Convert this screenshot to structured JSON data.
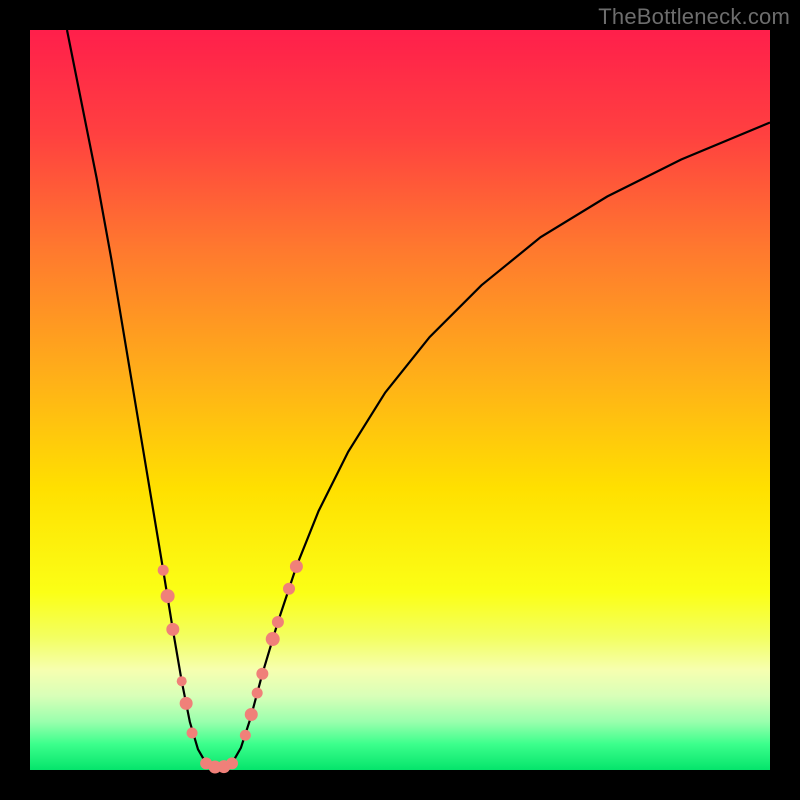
{
  "watermark": "TheBottleneck.com",
  "chart_data": {
    "type": "line",
    "title": "",
    "xlabel": "",
    "ylabel": "",
    "xlim": [
      0,
      100
    ],
    "ylim": [
      0,
      100
    ],
    "grid": false,
    "legend": false,
    "background_gradient": {
      "stops": [
        {
          "offset": 0.0,
          "color": "#ff1f4b"
        },
        {
          "offset": 0.14,
          "color": "#ff4040"
        },
        {
          "offset": 0.3,
          "color": "#ff7a2e"
        },
        {
          "offset": 0.48,
          "color": "#ffb317"
        },
        {
          "offset": 0.62,
          "color": "#ffe000"
        },
        {
          "offset": 0.76,
          "color": "#fbff16"
        },
        {
          "offset": 0.82,
          "color": "#f3ff60"
        },
        {
          "offset": 0.865,
          "color": "#f6ffb0"
        },
        {
          "offset": 0.9,
          "color": "#d8ffb8"
        },
        {
          "offset": 0.935,
          "color": "#99ffad"
        },
        {
          "offset": 0.965,
          "color": "#3cff8c"
        },
        {
          "offset": 1.0,
          "color": "#05e46b"
        }
      ]
    },
    "series": [
      {
        "name": "curve",
        "stroke": "#000000",
        "stroke_width": 2.2,
        "points": [
          {
            "x": 5.0,
            "y": 100.0
          },
          {
            "x": 7.0,
            "y": 90.0
          },
          {
            "x": 9.0,
            "y": 80.0
          },
          {
            "x": 11.0,
            "y": 69.0
          },
          {
            "x": 13.0,
            "y": 57.0
          },
          {
            "x": 15.0,
            "y": 45.0
          },
          {
            "x": 16.5,
            "y": 36.0
          },
          {
            "x": 18.0,
            "y": 27.0
          },
          {
            "x": 19.3,
            "y": 19.0
          },
          {
            "x": 20.5,
            "y": 12.0
          },
          {
            "x": 21.6,
            "y": 6.5
          },
          {
            "x": 22.7,
            "y": 2.8
          },
          {
            "x": 23.8,
            "y": 0.9
          },
          {
            "x": 25.6,
            "y": 0.3
          },
          {
            "x": 27.3,
            "y": 0.9
          },
          {
            "x": 28.5,
            "y": 3.0
          },
          {
            "x": 29.8,
            "y": 7.0
          },
          {
            "x": 31.4,
            "y": 13.0
          },
          {
            "x": 33.5,
            "y": 20.0
          },
          {
            "x": 36.0,
            "y": 27.5
          },
          {
            "x": 39.0,
            "y": 35.0
          },
          {
            "x": 43.0,
            "y": 43.0
          },
          {
            "x": 48.0,
            "y": 51.0
          },
          {
            "x": 54.0,
            "y": 58.5
          },
          {
            "x": 61.0,
            "y": 65.5
          },
          {
            "x": 69.0,
            "y": 72.0
          },
          {
            "x": 78.0,
            "y": 77.5
          },
          {
            "x": 88.0,
            "y": 82.5
          },
          {
            "x": 100.0,
            "y": 87.5
          }
        ]
      }
    ],
    "markers": {
      "color": "#f08079",
      "stroke": "#f08079",
      "groups": [
        {
          "name": "left-descending",
          "points": [
            {
              "x": 18.0,
              "y": 27.0,
              "r": 5.5
            },
            {
              "x": 18.6,
              "y": 23.5,
              "r": 7.0
            },
            {
              "x": 19.3,
              "y": 19.0,
              "r": 6.5
            },
            {
              "x": 20.5,
              "y": 12.0,
              "r": 5.0
            },
            {
              "x": 21.1,
              "y": 9.0,
              "r": 6.5
            },
            {
              "x": 21.9,
              "y": 5.0,
              "r": 5.5
            }
          ]
        },
        {
          "name": "valley-bottom",
          "points": [
            {
              "x": 23.8,
              "y": 0.9,
              "r": 6.0
            },
            {
              "x": 25.0,
              "y": 0.4,
              "r": 6.5
            },
            {
              "x": 26.2,
              "y": 0.45,
              "r": 6.5
            },
            {
              "x": 27.3,
              "y": 0.9,
              "r": 6.0
            }
          ]
        },
        {
          "name": "right-ascending",
          "points": [
            {
              "x": 29.1,
              "y": 4.7,
              "r": 5.5
            },
            {
              "x": 29.9,
              "y": 7.5,
              "r": 6.5
            },
            {
              "x": 30.7,
              "y": 10.4,
              "r": 5.5
            },
            {
              "x": 31.4,
              "y": 13.0,
              "r": 6.0
            },
            {
              "x": 32.8,
              "y": 17.7,
              "r": 7.0
            },
            {
              "x": 33.5,
              "y": 20.0,
              "r": 6.0
            },
            {
              "x": 35.0,
              "y": 24.5,
              "r": 6.0
            },
            {
              "x": 36.0,
              "y": 27.5,
              "r": 6.5
            }
          ]
        }
      ]
    }
  }
}
